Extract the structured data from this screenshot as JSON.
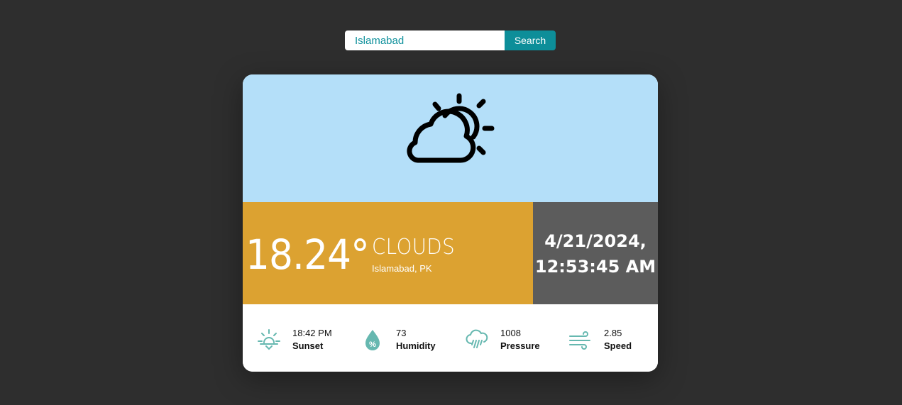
{
  "search": {
    "value": "Islamabad",
    "button_label": "Search"
  },
  "weather": {
    "icon": "partly-cloudy-icon",
    "temperature": "18.24°",
    "condition": "CLOUDS",
    "location": "Islamabad, PK",
    "date": "4/21/2024,",
    "time": "12:53:45 AM"
  },
  "stats": [
    {
      "icon": "sunset-icon",
      "value": "18:42 PM",
      "label": "Sunset"
    },
    {
      "icon": "humidity-icon",
      "value": "73",
      "label": "Humidity"
    },
    {
      "icon": "pressure-icon",
      "value": "1008",
      "label": "Pressure"
    },
    {
      "icon": "wind-icon",
      "value": "2.85",
      "label": "Speed"
    }
  ],
  "colors": {
    "background": "#2e2e2e",
    "accent": "#0d8e99",
    "sky": "#b4dff9",
    "temperature_panel": "#dca231",
    "datetime_panel": "#5c5c5c",
    "stat_icon": "#66b8b0"
  }
}
